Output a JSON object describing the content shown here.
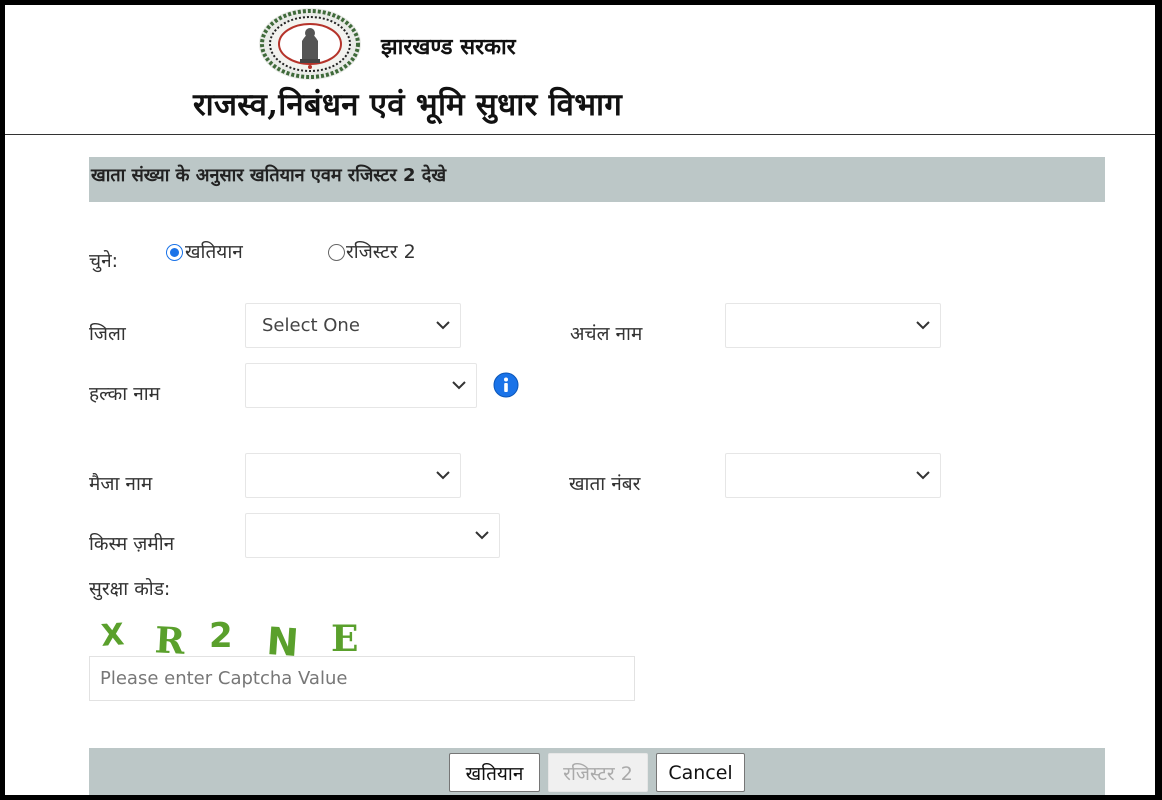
{
  "header": {
    "government": "झारखण्ड सरकार",
    "department": "राजस्व,निबंधन एवं भूमि सुधार  विभाग"
  },
  "section": {
    "title": "खाता संख्या के अनुसार खतियान एवम रजिस्टर 2 देखे"
  },
  "choose": {
    "label": "चुने:",
    "options": [
      {
        "label": "खतियान",
        "checked": true
      },
      {
        "label": "रजिस्टर 2",
        "checked": false
      }
    ]
  },
  "fields": {
    "district": {
      "label": "जिला",
      "value": "Select One"
    },
    "circle": {
      "label": "अचंल नाम",
      "value": ""
    },
    "halka": {
      "label": "हल्का नाम",
      "value": ""
    },
    "mauja": {
      "label": "मैजा नाम",
      "value": ""
    },
    "khata": {
      "label": "खाता नंबर",
      "value": ""
    },
    "land_type": {
      "label": "किस्म ज़मीन",
      "value": ""
    }
  },
  "captcha": {
    "label": "सुरक्षा कोड:",
    "text": "X R 2 N E",
    "placeholder": "Please enter Captcha Value",
    "color": "#5aa02c"
  },
  "buttons": {
    "khatiyan": "खतियान",
    "register2": "रजिस्टर 2",
    "cancel": "Cancel"
  },
  "colors": {
    "section_bar": "#bcc7c7",
    "radio_accent": "#1a73e8",
    "info_icon": "#1a73e8"
  }
}
